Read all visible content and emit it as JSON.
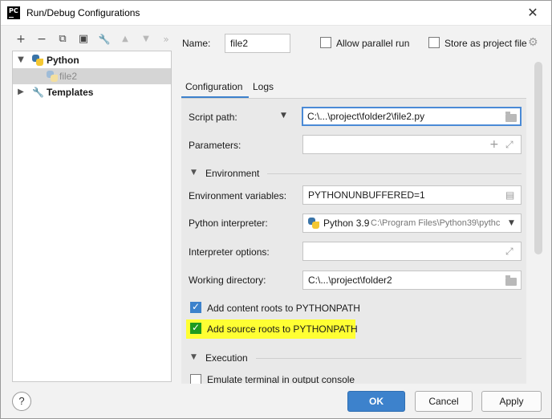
{
  "window": {
    "title": "Run/Debug Configurations",
    "app_icon_text": "PC"
  },
  "toolbar": {
    "add": "+",
    "remove": "−",
    "copy": "⧉",
    "save": "▣",
    "edit": "🔧",
    "move_up": "▲",
    "move_down": "▼",
    "more": "»"
  },
  "tree": {
    "python": {
      "label": "Python"
    },
    "file2": {
      "label": "file2"
    },
    "templates": {
      "label": "Templates"
    }
  },
  "header": {
    "name_label": "Name:",
    "name_value": "file2",
    "allow_parallel": "Allow parallel run",
    "store_project": "Store as project file"
  },
  "tabs": {
    "configuration": "Configuration",
    "logs": "Logs"
  },
  "form": {
    "script_path_label": "Script path:",
    "script_path_value": "C:\\...\\project\\folder2\\file2.py",
    "parameters_label": "Parameters:",
    "parameters_value": "",
    "environment_header": "Environment",
    "env_vars_label": "Environment variables:",
    "env_vars_value": "PYTHONUNBUFFERED=1",
    "interpreter_label": "Python interpreter:",
    "interpreter_name": "Python 3.9",
    "interpreter_path": "C:\\Program Files\\Python39\\pythc",
    "interpreter_options_label": "Interpreter options:",
    "interpreter_options_value": "",
    "working_dir_label": "Working directory:",
    "working_dir_value": "C:\\...\\project\\folder2",
    "content_roots_label": "Add content roots to PYTHONPATH",
    "source_roots_label": "Add source roots to PYTHONPATH",
    "execution_header": "Execution",
    "emulate_terminal_label": "Emulate terminal in output console"
  },
  "buttons": {
    "help": "?",
    "ok": "OK",
    "cancel": "Cancel",
    "apply": "Apply"
  },
  "colors": {
    "accent": "#3d82cc",
    "highlight": "#ffff33",
    "checked_green": "#1f9b1f"
  }
}
